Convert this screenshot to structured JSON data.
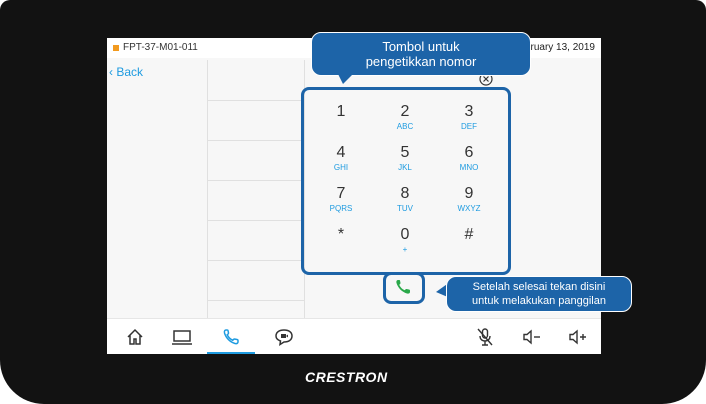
{
  "status_bar": {
    "room_name": "FPT-37-M01-011",
    "date": "ruary 13, 2019"
  },
  "nav": {
    "back_label": "Back"
  },
  "keypad": {
    "keys": [
      {
        "digit": "1",
        "letters": ""
      },
      {
        "digit": "2",
        "letters": "ABC"
      },
      {
        "digit": "3",
        "letters": "DEF"
      },
      {
        "digit": "4",
        "letters": "GHI"
      },
      {
        "digit": "5",
        "letters": "JKL"
      },
      {
        "digit": "6",
        "letters": "MNO"
      },
      {
        "digit": "7",
        "letters": "PQRS"
      },
      {
        "digit": "8",
        "letters": "TUV"
      },
      {
        "digit": "9",
        "letters": "WXYZ"
      },
      {
        "digit": "*",
        "letters": ""
      },
      {
        "digit": "0",
        "letters": "+"
      },
      {
        "digit": "#",
        "letters": ""
      }
    ]
  },
  "callouts": {
    "keypad_line1": "Tombol untuk",
    "keypad_line2": "pengetikkan nomor",
    "call_line1": "Setelah selesai tekan disini",
    "call_line2": "untuk melakukan panggilan"
  },
  "bottom_nav": {
    "items": [
      "home-icon",
      "laptop-icon",
      "phone-icon",
      "video-call-icon",
      "mic-muted-icon",
      "volume-down-icon",
      "volume-up-icon"
    ],
    "active": "phone-icon"
  },
  "brand": {
    "name": "CRESTRON"
  },
  "colors": {
    "accent": "#1e9be0",
    "callout": "#1d64a8",
    "call_green": "#2aa84a",
    "status_orange": "#f29a1f"
  }
}
